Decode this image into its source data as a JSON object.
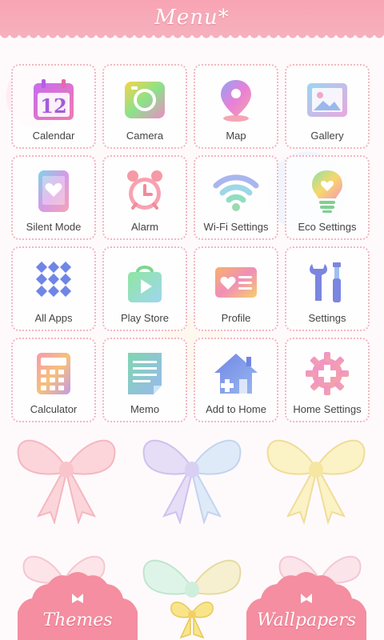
{
  "header": {
    "title": "Menu*"
  },
  "apps": [
    {
      "label": "Calendar",
      "icon": "calendar-icon",
      "day": "12"
    },
    {
      "label": "Camera",
      "icon": "camera-icon"
    },
    {
      "label": "Map",
      "icon": "map-pin-icon"
    },
    {
      "label": "Gallery",
      "icon": "gallery-icon"
    },
    {
      "label": "Silent Mode",
      "icon": "silent-mode-icon"
    },
    {
      "label": "Alarm",
      "icon": "alarm-clock-icon"
    },
    {
      "label": "Wi-Fi Settings",
      "icon": "wifi-icon"
    },
    {
      "label": "Eco Settings",
      "icon": "lightbulb-icon"
    },
    {
      "label": "All Apps",
      "icon": "app-grid-icon"
    },
    {
      "label": "Play Store",
      "icon": "play-store-icon"
    },
    {
      "label": "Profile",
      "icon": "profile-card-icon"
    },
    {
      "label": "Settings",
      "icon": "tools-icon"
    },
    {
      "label": "Calculator",
      "icon": "calculator-icon"
    },
    {
      "label": "Memo",
      "icon": "memo-icon"
    },
    {
      "label": "Add to Home",
      "icon": "add-home-icon"
    },
    {
      "label": "Home Settings",
      "icon": "gear-plus-icon"
    }
  ],
  "buttons": {
    "themes": "Themes",
    "wallpapers": "Wallpapers"
  },
  "colors": {
    "header_pink": "#f6b0bd",
    "accent_pink": "#f28a9c",
    "tile_border": "#f3b6bf"
  }
}
